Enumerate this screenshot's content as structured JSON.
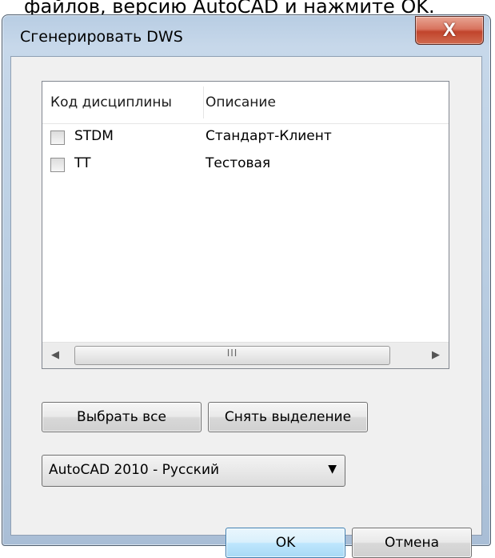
{
  "background": {
    "text": "файлов, версию AutoCAD и нажмите OK."
  },
  "window": {
    "title": "Сгенерировать DWS",
    "close_glyph": "X"
  },
  "list": {
    "columns": [
      "Код дисциплины",
      "Описание"
    ],
    "rows": [
      {
        "code": "STDM",
        "description": "Стандарт-Клиент",
        "checked": false
      },
      {
        "code": "TT",
        "description": "Тестовая",
        "checked": false
      }
    ],
    "scrollbar": {
      "left_arrow": "◀",
      "right_arrow": "▶",
      "grip": "III"
    }
  },
  "buttons": {
    "select_all": "Выбрать все",
    "deselect": "Снять выделение",
    "ok": "OK",
    "cancel": "Отмена"
  },
  "version_select": {
    "selected": "AutoCAD 2010 - Русский",
    "arrow": "▼"
  },
  "colors": {
    "ok_border": "#3c7fb1",
    "close_red": "#c1442c",
    "frame": "#b8cde3"
  },
  "icons": [
    "close-icon",
    "checkbox",
    "scroll-left-arrow-icon",
    "scroll-right-arrow-icon",
    "dropdown-arrow-icon"
  ]
}
